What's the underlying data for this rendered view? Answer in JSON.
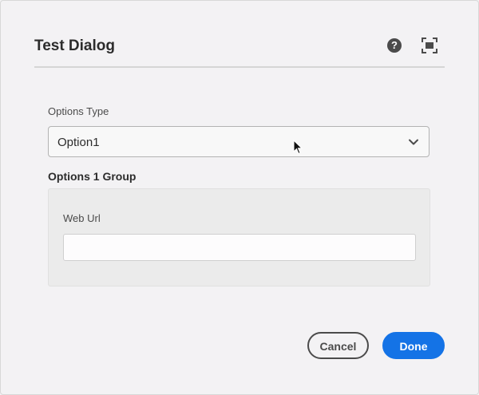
{
  "dialog": {
    "title": "Test Dialog",
    "help_symbol": "?"
  },
  "icons": {
    "help": "help-icon",
    "fullscreen": "fullscreen-icon",
    "dropdown": "chevron-down-icon",
    "cursor": "mouse-cursor-icon"
  },
  "options_type": {
    "label": "Options Type",
    "selected_value": "Option1"
  },
  "options_group": {
    "title": "Options 1 Group",
    "web_url": {
      "label": "Web Url",
      "value": "",
      "placeholder": ""
    }
  },
  "footer": {
    "cancel_label": "Cancel",
    "done_label": "Done"
  },
  "colors": {
    "primary": "#1473e6",
    "background": "#f3f2f4",
    "text": "#2c2c2c"
  }
}
